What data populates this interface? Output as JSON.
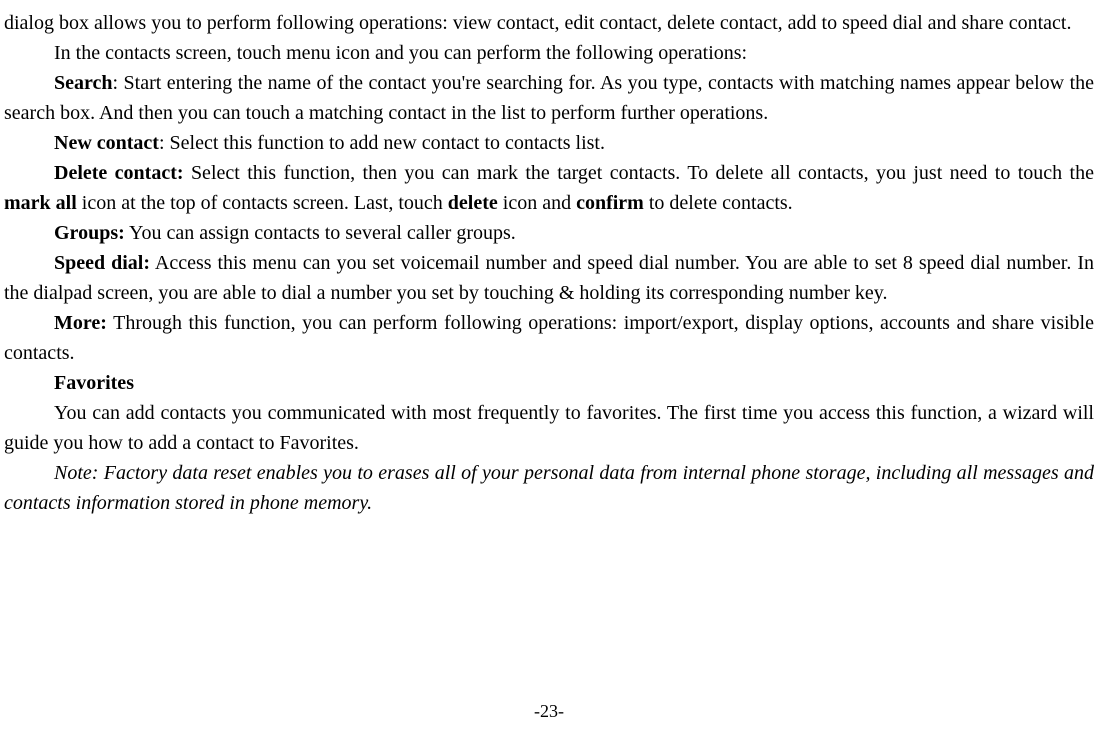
{
  "paragraphs": {
    "p1": "dialog box allows you to perform following operations: view contact, edit contact, delete contact, add to speed dial and share contact.",
    "p2": "In the contacts screen, touch menu icon and you can perform the following operations:",
    "p3_bold": "Search",
    "p3_rest": ": Start entering the name of the contact you're searching for. As you type, contacts with matching names appear below the search box. And then you can touch a matching contact in the list to perform further operations.",
    "p4_bold": "New contact",
    "p4_rest": ": Select this function to add new contact to contacts list.",
    "p5_bold": "Delete contact:",
    "p5_rest1": " Select this function, then you can mark the target contacts. To delete all contacts, you just need to touch the ",
    "p5_bold2": "mark all",
    "p5_rest2": " icon at the top of contacts screen. Last, touch ",
    "p5_bold3": "delete",
    "p5_rest3": " icon and ",
    "p5_bold4": "confirm",
    "p5_rest4": " to delete contacts.",
    "p6_bold": "Groups:",
    "p6_rest": " You can assign contacts to several caller groups.",
    "p7_bold": "Speed dial:",
    "p7_rest": " Access this menu can you set voicemail number and speed dial number. You are able to set 8 speed dial number. In the dialpad screen, you are able to dial a number you set by touching & holding its corresponding number key.",
    "p8_bold": "More:",
    "p8_rest": " Through this function, you can perform following operations: import/export, display options, accounts and share visible contacts.",
    "p9_bold": "Favorites",
    "p10": "You can add contacts you communicated with most frequently to favorites. The first time you access this function, a wizard will guide you how to add a contact to Favorites.",
    "p11": "Note: Factory data reset enables you to erases all of your personal data from internal phone storage, including all messages and contacts information stored in phone memory.",
    "page_number": "-23-"
  }
}
